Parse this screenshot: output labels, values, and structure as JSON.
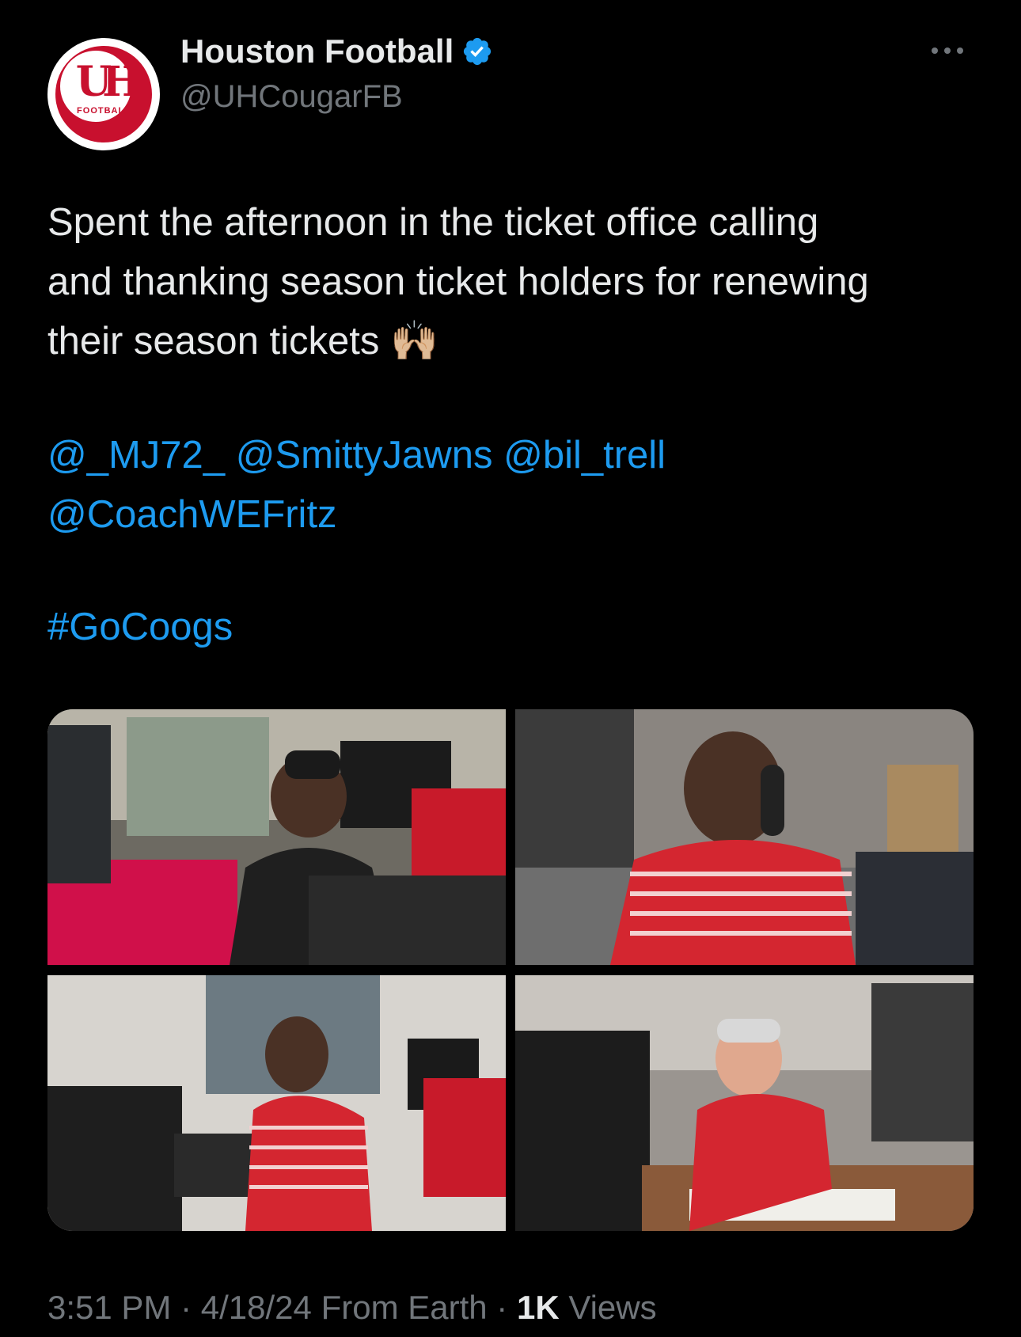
{
  "account": {
    "display_name": "Houston Football",
    "handle": "@UHCougarFB",
    "avatar_logo_text": "UH",
    "avatar_sub_text": "FOOTBALL"
  },
  "tweet": {
    "text_lines": [
      "Spent the afternoon in the ticket office calling",
      "and thanking season ticket holders for renewing",
      "their season tickets 🙌🏼"
    ],
    "mentions": [
      "@_MJ72_",
      "@SmittyJawns",
      "@bil_trell",
      "@CoachWEFritz"
    ],
    "hashtag": "#GoCoogs"
  },
  "meta": {
    "time": "3:51 PM",
    "date": "4/18/24",
    "source": "From Earth",
    "views_count": "1K",
    "views_label": "Views",
    "separator": "·"
  },
  "colors": {
    "background": "#000000",
    "text": "#e7e9ea",
    "secondary": "#71767b",
    "link": "#1d9bf0",
    "brand_red": "#c8102e"
  },
  "icons": {
    "verified": "verified-badge-icon",
    "more": "more-options-icon"
  }
}
